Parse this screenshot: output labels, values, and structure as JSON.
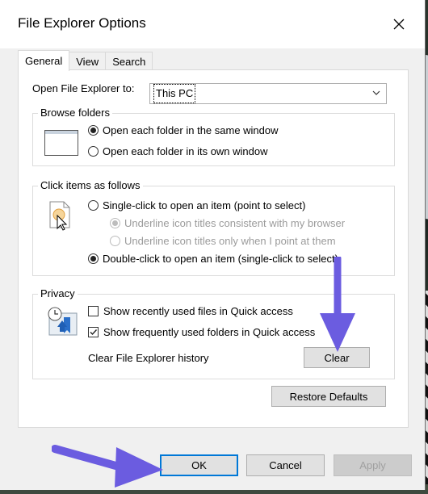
{
  "window": {
    "title": "File Explorer Options"
  },
  "tabs": [
    {
      "label": "General"
    },
    {
      "label": "View"
    },
    {
      "label": "Search"
    }
  ],
  "general": {
    "open_label": "Open File Explorer to:",
    "open_value": "This PC",
    "browse": {
      "legend": "Browse folders",
      "options": [
        {
          "label": "Open each folder in the same window",
          "selected": true
        },
        {
          "label": "Open each folder in its own window",
          "selected": false
        }
      ]
    },
    "click": {
      "legend": "Click items as follows",
      "options": [
        {
          "label": "Single-click to open an item (point to select)",
          "selected": false
        },
        {
          "label": "Underline icon titles consistent with my browser",
          "selected": true,
          "disabled": true
        },
        {
          "label": "Underline icon titles only when I point at them",
          "selected": false,
          "disabled": true
        },
        {
          "label": "Double-click to open an item (single-click to select)",
          "selected": true
        }
      ]
    },
    "privacy": {
      "legend": "Privacy",
      "checks": [
        {
          "label": "Show recently used files in Quick access",
          "checked": false
        },
        {
          "label": "Show frequently used folders in Quick access",
          "checked": true
        }
      ],
      "history_label": "Clear File Explorer history",
      "clear_button": "Clear"
    },
    "restore_button": "Restore Defaults"
  },
  "footer": {
    "ok": "OK",
    "cancel": "Cancel",
    "apply": "Apply"
  },
  "colors": {
    "accent": "#0078d7",
    "arrow": "#6b5ce0"
  }
}
